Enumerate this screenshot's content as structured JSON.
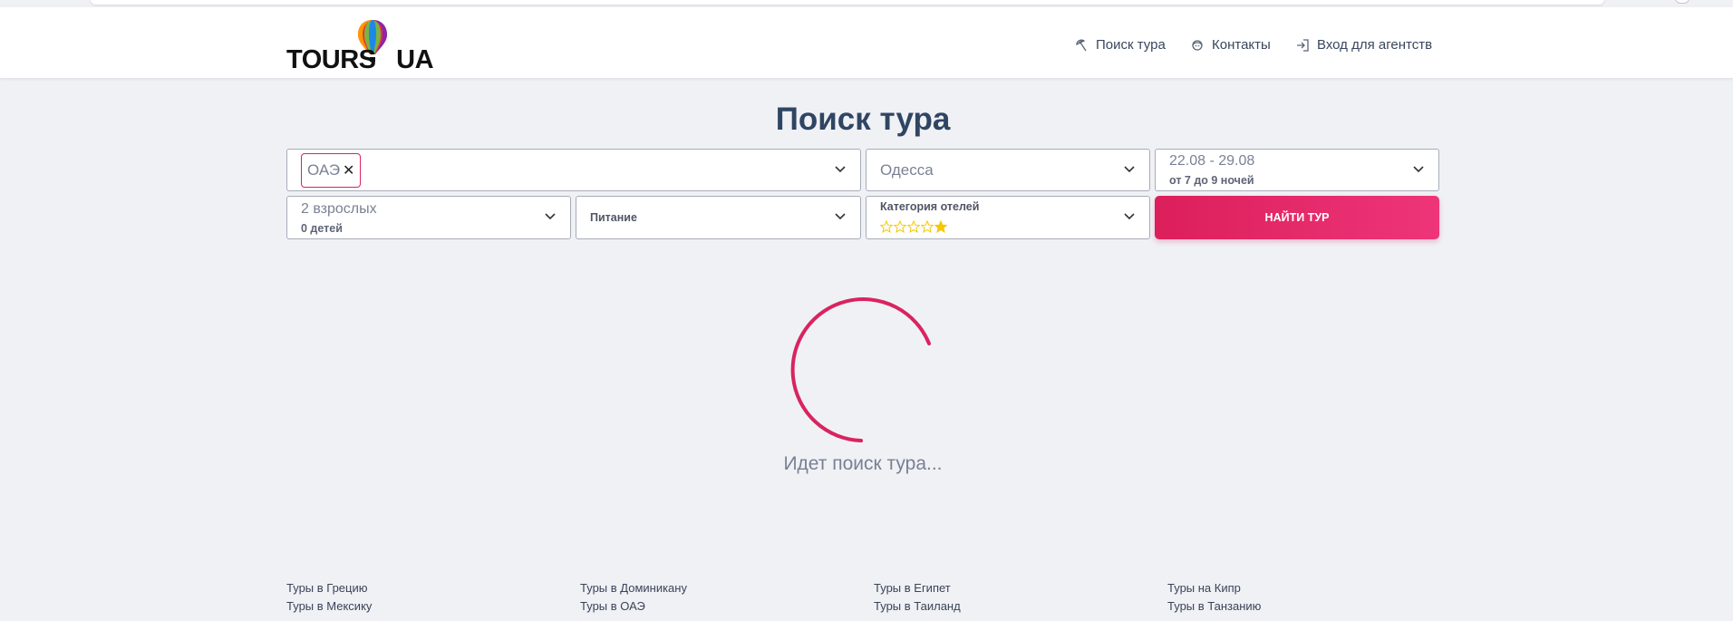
{
  "header": {
    "logo_text": "TOURS   UA",
    "nav": [
      {
        "label": "Поиск тура",
        "icon": "beach-umbrella-icon"
      },
      {
        "label": "Контакты",
        "icon": "support-agent-icon"
      },
      {
        "label": "Вход для агентств",
        "icon": "login-icon"
      }
    ]
  },
  "search": {
    "title": "Поиск тура",
    "destination_tag": "ОАЭ",
    "departure_city": "Одесса",
    "dates": "22.08 - 29.08",
    "nights": "от 7 до 9 ночей",
    "adults": "2 взрослых",
    "children": "0 детей",
    "meals_label": "Питание",
    "hotel_category_label": "Категория отелей",
    "stars": [
      false,
      false,
      false,
      false,
      true
    ],
    "search_button": "НАЙТИ ТУР",
    "accent_color": "#dc1f5b",
    "star_color": "#f5c800"
  },
  "status": {
    "loading_text": "Идет поиск тура..."
  },
  "footer": {
    "columns": [
      [
        "Туры в Грецию",
        "Туры в Мексику"
      ],
      [
        "Туры в Доминикану",
        "Туры в ОАЭ"
      ],
      [
        "Туры в Египет",
        "Туры в Таиланд"
      ],
      [
        "Туры на Кипр",
        "Туры в Танзанию"
      ]
    ]
  }
}
